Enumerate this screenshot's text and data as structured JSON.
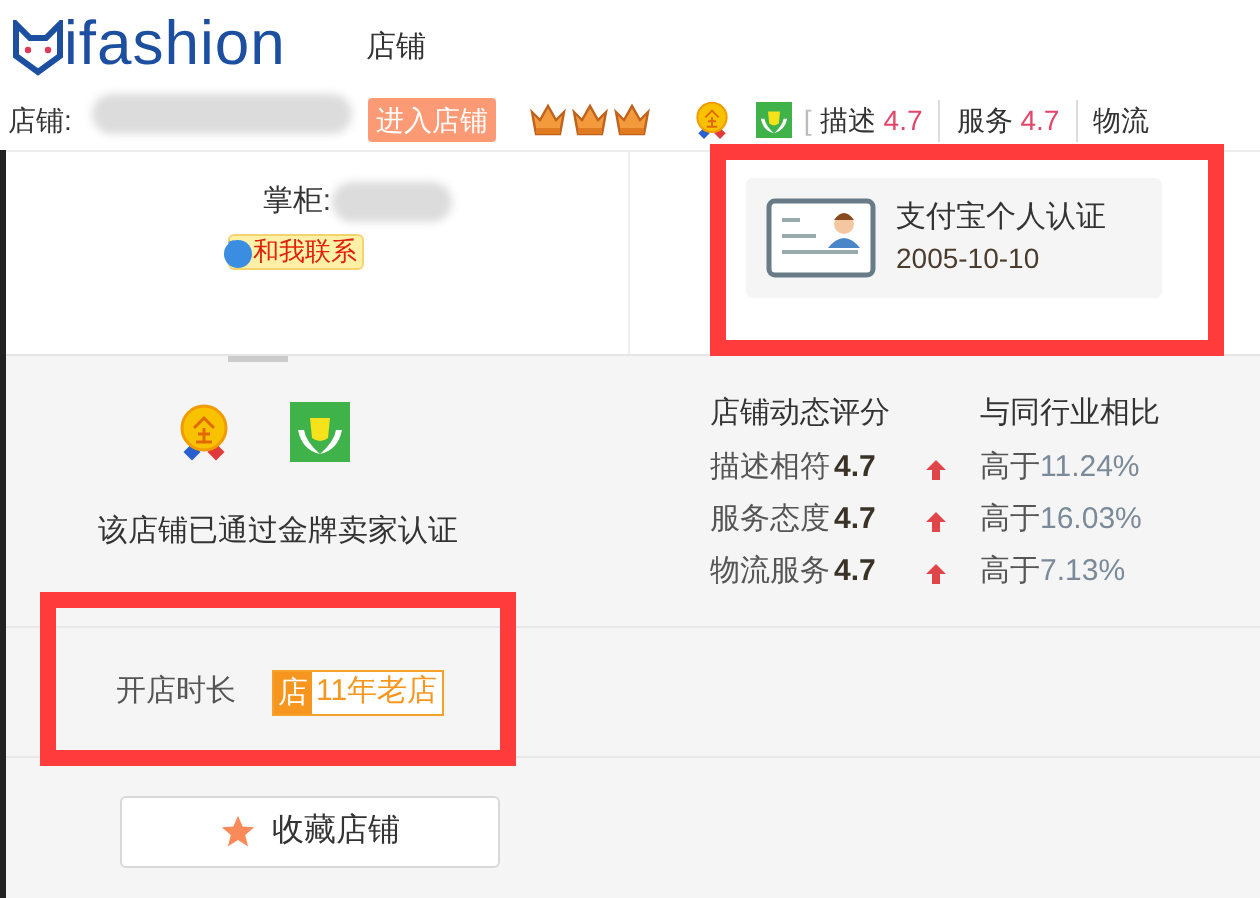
{
  "header": {
    "logo": "ifashion",
    "title": "店铺"
  },
  "shop_bar": {
    "label": "店铺:",
    "enter_button": "进入店铺",
    "bracket": "[",
    "scores": [
      {
        "label": "描述",
        "value": "4.7"
      },
      {
        "label": "服务",
        "value": "4.7"
      },
      {
        "label": "物流"
      }
    ]
  },
  "owner": {
    "label": "掌柜:",
    "contact_button": "和我联系"
  },
  "certification": {
    "title": "支付宝个人认证",
    "date": "2005-10-10"
  },
  "gold_seller_text": "该店铺已通过金牌卖家认证",
  "ratings": {
    "heading": "店铺动态评分",
    "compare_heading": "与同行业相比",
    "rows": [
      {
        "label": "描述相符",
        "score": "4.7",
        "kind": "up",
        "compare_label": "高于",
        "compare_value": "11.24%"
      },
      {
        "label": "服务态度",
        "score": "4.7",
        "kind": "up",
        "compare_label": "高于",
        "compare_value": "16.03%"
      },
      {
        "label": "物流服务",
        "score": "4.7",
        "kind": "up",
        "compare_label": "高于",
        "compare_value": "7.13%"
      }
    ]
  },
  "shop_age": {
    "label": "开店时长",
    "badge_icon": "店",
    "badge_text": "11年老店"
  },
  "favorite_button": "收藏店铺"
}
